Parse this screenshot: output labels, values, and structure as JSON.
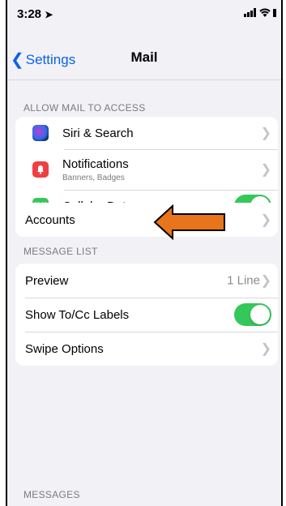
{
  "status_bar": {
    "time": "3:28",
    "location_icon": "location-arrow-icon",
    "signal_icon": "signal-bars-icon",
    "wifi_icon": "wifi-icon"
  },
  "nav": {
    "back_label": "Settings",
    "title": "Mail"
  },
  "allow_section": {
    "header": "ALLOW MAIL TO ACCESS",
    "items": [
      {
        "label": "Siri & Search",
        "icon": "siri-icon"
      },
      {
        "label": "Notifications",
        "sublabel": "Banners, Badges",
        "icon": "bell-icon"
      },
      {
        "label": "Cellular Data",
        "icon": "cellular-antenna-icon",
        "toggle": true
      }
    ]
  },
  "accounts": {
    "label": "Accounts"
  },
  "annotation": {
    "arrow_color": "#e8741c"
  },
  "message_list": {
    "header": "MESSAGE LIST",
    "items": [
      {
        "label": "Preview",
        "value": "1 Line"
      },
      {
        "label": "Show To/Cc Labels",
        "toggle": true
      },
      {
        "label": "Swipe Options"
      }
    ]
  },
  "messages": {
    "header": "MESSAGES"
  },
  "colors": {
    "accent": "#0a62ea",
    "toggle_on": "#34c759",
    "background": "#f1f1f6"
  }
}
